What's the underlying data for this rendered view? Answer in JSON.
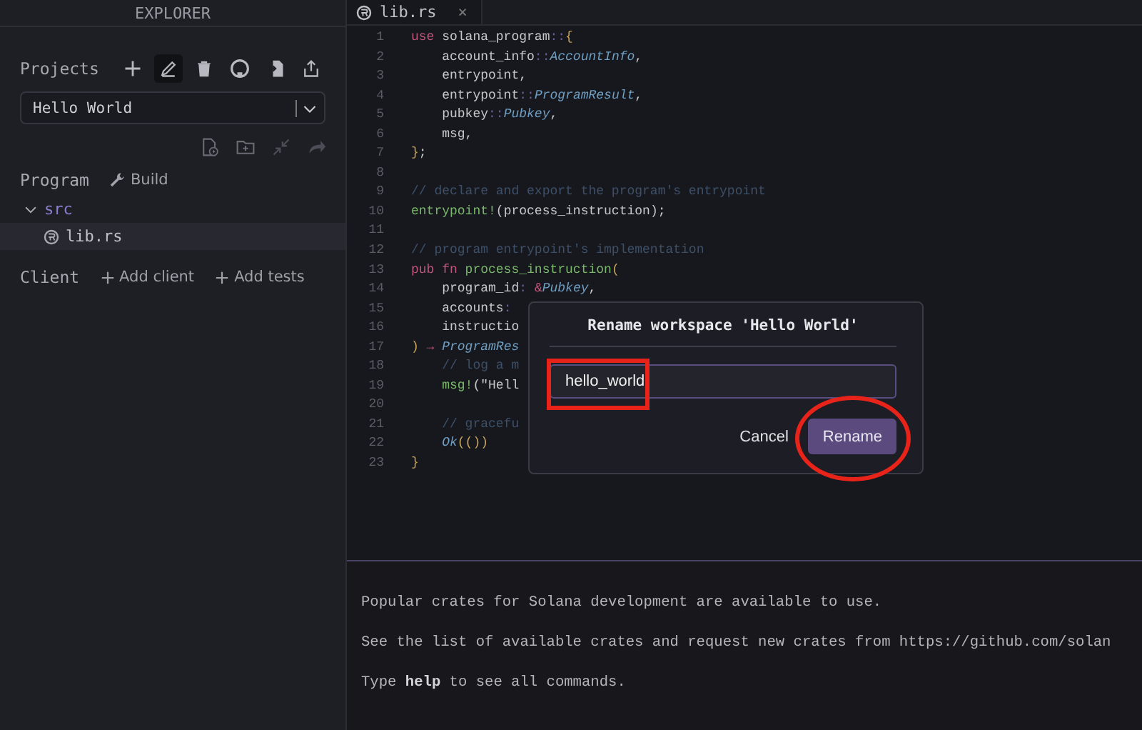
{
  "sidebar": {
    "title": "EXPLORER",
    "projects": {
      "label": "Projects",
      "tools": [
        {
          "kind": "plus",
          "hovered": false
        },
        {
          "kind": "pencil",
          "hovered": true
        },
        {
          "kind": "trash",
          "hovered": false
        },
        {
          "kind": "logo",
          "hovered": false
        },
        {
          "kind": "import",
          "hovered": false
        },
        {
          "kind": "share",
          "hovered": false
        }
      ],
      "selected_project": "Hello World"
    },
    "file_tools": [
      {
        "kind": "file-play",
        "disabled": false
      },
      {
        "kind": "folder-plus",
        "disabled": false
      },
      {
        "kind": "collapse",
        "disabled": true
      },
      {
        "kind": "redo",
        "disabled": true
      }
    ],
    "program": {
      "label": "Program",
      "build": "Build"
    },
    "tree": [
      {
        "name": "src",
        "kind": "folder",
        "expanded": true,
        "children": [
          {
            "name": "lib.rs",
            "kind": "rust",
            "selected": true
          }
        ]
      }
    ],
    "client": {
      "label": "Client",
      "actions": [
        "Add client",
        "Add tests"
      ]
    }
  },
  "tabs": [
    {
      "label": "lib.rs",
      "selected": true,
      "close": "×"
    }
  ],
  "code": [
    {
      "n": "1",
      "tokens": [
        {
          "text": "use",
          "kind": "kw"
        },
        {
          "text": " solana_program",
          "kind": "id"
        },
        {
          "text": "::",
          "kind": "op"
        },
        {
          "text": "{",
          "kind": "punc"
        }
      ]
    },
    {
      "n": "2",
      "tokens": [
        {
          "text": "    account_info",
          "kind": "id"
        },
        {
          "text": "::",
          "kind": "op"
        },
        {
          "text": "AccountInfo",
          "kind": "type"
        },
        {
          "text": ",",
          "kind": "id"
        }
      ]
    },
    {
      "n": "3",
      "tokens": [
        {
          "text": "    entrypoint,",
          "kind": "id"
        }
      ]
    },
    {
      "n": "4",
      "tokens": [
        {
          "text": "    entrypoint",
          "kind": "id"
        },
        {
          "text": "::",
          "kind": "op"
        },
        {
          "text": "ProgramResult",
          "kind": "type"
        },
        {
          "text": ",",
          "kind": "id"
        }
      ]
    },
    {
      "n": "5",
      "tokens": [
        {
          "text": "    pubkey",
          "kind": "id"
        },
        {
          "text": "::",
          "kind": "op"
        },
        {
          "text": "Pubkey",
          "kind": "type"
        },
        {
          "text": ",",
          "kind": "id"
        }
      ]
    },
    {
      "n": "6",
      "tokens": [
        {
          "text": "    msg,",
          "kind": "id"
        }
      ]
    },
    {
      "n": "7",
      "tokens": [
        {
          "text": "}",
          "kind": "punc"
        },
        {
          "text": ";",
          "kind": "id"
        }
      ]
    },
    {
      "n": "8"
    },
    {
      "n": "9",
      "tokens": [
        {
          "text": "// declare and export the program's entrypoint",
          "kind": "comment"
        }
      ]
    },
    {
      "n": "10",
      "tokens": [
        {
          "text": "entrypoint!",
          "kind": "fn"
        },
        {
          "text": "(process_instruction);",
          "kind": "id"
        }
      ]
    },
    {
      "n": "11"
    },
    {
      "n": "12",
      "tokens": [
        {
          "text": "// program entrypoint's implementation",
          "kind": "comment"
        }
      ]
    },
    {
      "n": "13",
      "tokens": [
        {
          "text": "pub fn",
          "kind": "kw"
        },
        {
          "text": " process_instruction",
          "kind": "fn"
        },
        {
          "text": "(",
          "kind": "punc"
        }
      ]
    },
    {
      "n": "14",
      "tokens": [
        {
          "text": "    program_id",
          "kind": "id"
        },
        {
          "text": ": ",
          "kind": "op"
        },
        {
          "text": "&",
          "kind": "kw"
        },
        {
          "text": "Pubkey",
          "kind": "type"
        },
        {
          "text": ",",
          "kind": "id"
        }
      ]
    },
    {
      "n": "15",
      "tokens": [
        {
          "text": "    accounts",
          "kind": "id"
        },
        {
          "text": ":",
          "kind": "op"
        }
      ]
    },
    {
      "n": "16",
      "tokens": [
        {
          "text": "    instructio",
          "kind": "id"
        }
      ]
    },
    {
      "n": "17",
      "tokens": [
        {
          "text": ")",
          "kind": "punc"
        },
        {
          "text": " → ",
          "kind": "kw"
        },
        {
          "text": "ProgramRes",
          "kind": "type"
        }
      ]
    },
    {
      "n": "18",
      "tokens": [
        {
          "text": "    // log a m",
          "kind": "comment"
        }
      ]
    },
    {
      "n": "19",
      "tokens": [
        {
          "text": "    msg!",
          "kind": "fn"
        },
        {
          "text": "(\"Hell",
          "kind": "id"
        }
      ]
    },
    {
      "n": "20"
    },
    {
      "n": "21",
      "tokens": [
        {
          "text": "    // gracefu",
          "kind": "comment"
        }
      ]
    },
    {
      "n": "22",
      "tokens": [
        {
          "text": "    Ok",
          "kind": "type"
        },
        {
          "text": "(())",
          "kind": "punc"
        }
      ]
    },
    {
      "n": "23",
      "tokens": [
        {
          "text": "}",
          "kind": "punc"
        }
      ]
    }
  ],
  "terminal": {
    "lines": [
      "Popular crates for Solana development are available to use.",
      "See the list of available crates and request new crates from https://github.com/solan",
      "Type **help** to see all commands."
    ]
  },
  "dialog": {
    "title": "Rename workspace 'Hello World'",
    "value": "hello_world",
    "buttons": [
      {
        "label": "Cancel",
        "kind": "secondary"
      },
      {
        "label": "Rename",
        "kind": "primary"
      }
    ]
  },
  "annotations": [
    {
      "kind": "rect"
    },
    {
      "kind": "ellipse"
    }
  ]
}
